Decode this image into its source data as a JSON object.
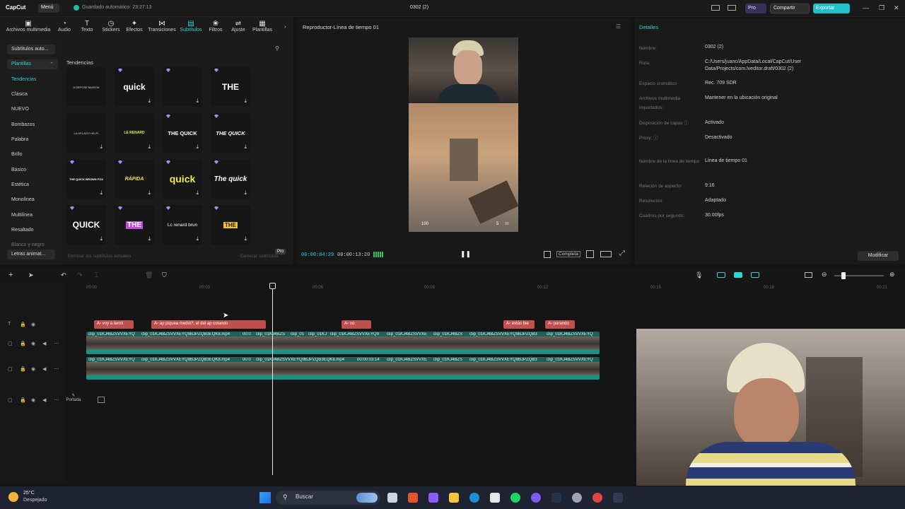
{
  "app": {
    "logo": "CapCut",
    "menu_label": "Menú",
    "autosave": "Guardado automático: 23:27:13",
    "project_title": "0302 (2)",
    "pro_label": "Pro",
    "share_label": "Compartir",
    "export_label": "Exportar"
  },
  "toolbar": {
    "tabs": [
      {
        "label": "Archivos multimedia",
        "icon": "media-icon"
      },
      {
        "label": "Audio",
        "icon": "audio-icon"
      },
      {
        "label": "Texto",
        "icon": "text-icon"
      },
      {
        "label": "Stickers",
        "icon": "sticker-icon"
      },
      {
        "label": "Efectos",
        "icon": "effects-icon"
      },
      {
        "label": "Transiciones",
        "icon": "transitions-icon"
      },
      {
        "label": "Subtítulos",
        "icon": "captions-icon"
      },
      {
        "label": "Filtros",
        "icon": "filters-icon"
      },
      {
        "label": "Ajuste",
        "icon": "adjust-icon"
      },
      {
        "label": "Plantillas",
        "icon": "templates-icon"
      }
    ]
  },
  "leftnav": {
    "autosub": "Subtítulos auto...",
    "templates": "Plantillas",
    "items": [
      "Tendencias",
      "Clásica",
      "NUEVO",
      "Bombazos",
      "Palabra",
      "Brillo",
      "Básico",
      "Estética",
      "Monolínea",
      "Multilínea",
      "Resaltado",
      "Blanco y negro"
    ],
    "letters": "Letras animat..."
  },
  "grid": {
    "title": "Tendencias",
    "tiles": [
      {
        "text": "A DEPOSE MAISON",
        "color": "#dddddd",
        "gem": false
      },
      {
        "text": "quick",
        "color": "#ffffff",
        "gem": true
      },
      {
        "text": "",
        "color": "#ffffff",
        "gem": true
      },
      {
        "text": "THE",
        "color": "#ffffff",
        "gem": true
      },
      {
        "text": "LA HELADO HELPI",
        "color": "#cccccc",
        "gem": false
      },
      {
        "text": "LE RENARD",
        "color": "#e0f050",
        "gem": false
      },
      {
        "text": "THE QUICK",
        "color": "#ffffff",
        "gem": true
      },
      {
        "text": "THE QUICK",
        "color": "#ffffff",
        "gem": true
      },
      {
        "text": "THE QUICK BROWN FOX",
        "color": "#ffffff",
        "gem": true
      },
      {
        "text": "RÁPIDA",
        "color": "#f4e04d",
        "gem": true
      },
      {
        "text": "quick",
        "color": "#f2ea46",
        "gem": true
      },
      {
        "text": "The quick",
        "color": "#ffffff",
        "gem": true
      },
      {
        "text": "QUICK",
        "color": "#ffffff",
        "gem": true
      },
      {
        "text": "THE",
        "color": "#ffffff",
        "gem": true
      },
      {
        "text": "Lc renard brun",
        "color": "#ffffff",
        "gem": true
      },
      {
        "text": "THE",
        "color": "#222222",
        "gem": true
      }
    ],
    "footer": "Eliminar los subtítulos actuales",
    "generate": "Generar subtítulos",
    "pro_tag": "Pro"
  },
  "player": {
    "title": "Reproductor-Línea de tiempo 01",
    "time_current": "00:00:04:29",
    "time_total": "00:00:13:20",
    "ratio": "Completa",
    "hud_left": "100",
    "hud_mid": "5",
    "hud_right": "30"
  },
  "details": {
    "title": "Detalles",
    "rows": [
      {
        "key": "Nombre:",
        "value": "0302 (2)"
      },
      {
        "key": "Ruta:",
        "value": "C:/Users/juanc/AppData/Local/CapCut/User Data/Projects/com.lveditor.draft/0302 (2)"
      },
      {
        "key": "Espacio cromático",
        "value": "Rec. 709 SDR"
      },
      {
        "key": "Archivos multimedia importados:",
        "value": "Mantener en la ubicación original"
      },
      {
        "key": "Disposición de capas",
        "value": "Activado"
      },
      {
        "key": "Proxy:",
        "value": "Desactivado"
      },
      {
        "key": "Nombre de la línea de tiempo",
        "value": "Línea de tiempo 01"
      },
      {
        "key": "Relación de aspecto:",
        "value": "9:16"
      },
      {
        "key": "Resolución:",
        "value": "Adaptado"
      },
      {
        "key": "Cuadros por segundo:",
        "value": "30.00fps"
      }
    ],
    "modify": "Modificar"
  },
  "timeline": {
    "ruler": [
      "00:00",
      "00:03",
      "00:06",
      "00:09",
      "00:12",
      "00:15",
      "00:18",
      "00:21"
    ],
    "subtitles": [
      "voy a termi",
      "ap piquea medio?, el del ap colando",
      "no",
      "estás bie",
      "parando"
    ],
    "video_labels_top": [
      "clip_01KJ4BZSVVXEYQ",
      "clip_01KJ4BZSVVXEYQ9BJPZQB3EQK8.mp4",
      "00:0",
      "clip_01KJ4BZS",
      "clip_01",
      "clip_01KJ",
      "clip_01KJ4BZSVVXEYQ9",
      "clip_01KJ4BZSVVXE",
      "clip_01KJ4BZS",
      "clip_01KJ4BZSVVXEYQ9BJPZQB3",
      "clip_01KJ4BZSVVXEYQ"
    ],
    "video_labels_bottom": [
      "clip_01KJ4BZSVVXEYQ",
      "clip_01KJ4BZSVVXEYQ9BJPZQB3EQK8.mp4",
      "00:0",
      "clip_01KJ4BZSVVXEYQ9BJPZQB3EQK8.mp4",
      "00:00:03:14",
      "clip_01KJ4BZSVVXE",
      "clip_01KJ4BZS",
      "clip_01KJ4BZSVVXEYQ9BJPZQB3",
      "clip_01KJ4BZSVVXEYQ"
    ],
    "cover_label": "Portada"
  },
  "taskbar": {
    "temp": "25°C",
    "weather": "Despejado",
    "search": "Buscar"
  }
}
